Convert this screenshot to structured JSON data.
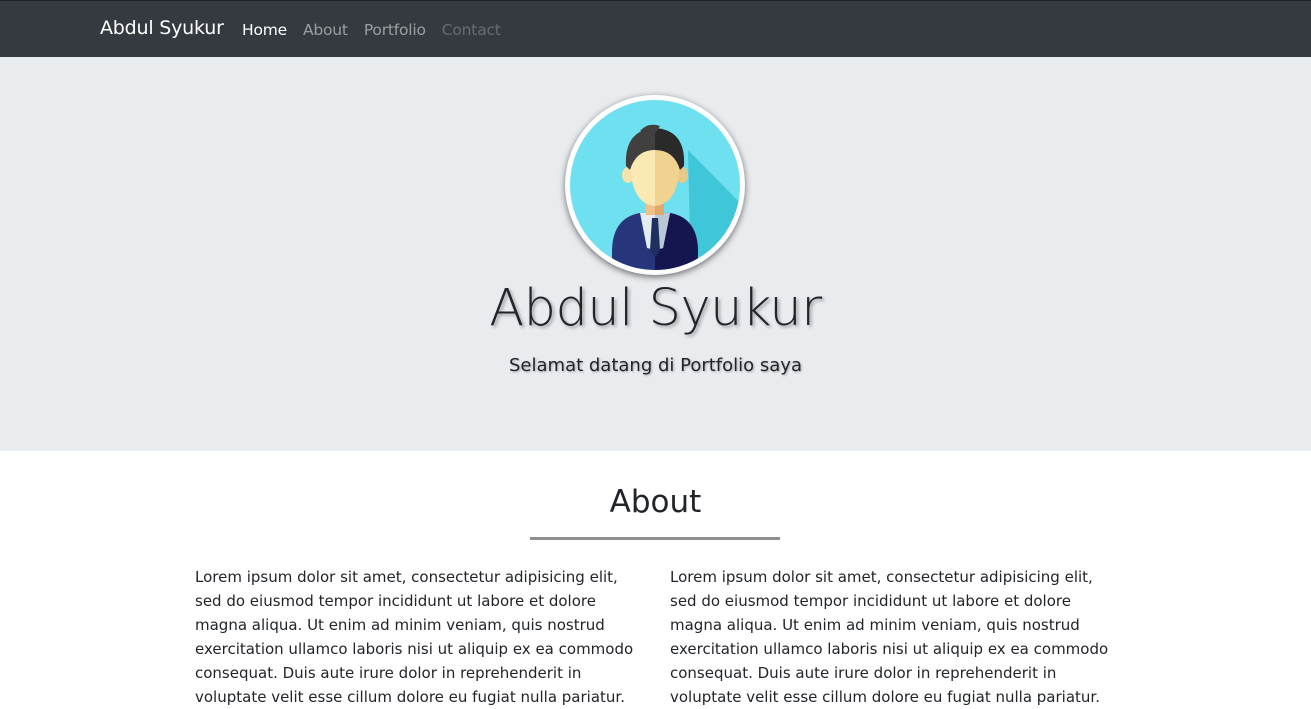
{
  "navbar": {
    "brand": "Abdul Syukur",
    "items": [
      {
        "label": "Home",
        "state": "active"
      },
      {
        "label": "About",
        "state": "normal"
      },
      {
        "label": "Portfolio",
        "state": "normal"
      },
      {
        "label": "Contact",
        "state": "dim"
      }
    ]
  },
  "hero": {
    "avatar_icon": "businessman-avatar-icon",
    "name": "Abdul Syukur",
    "tagline": "Selamat datang di Portfolio saya"
  },
  "about": {
    "title": "About",
    "columns": [
      "Lorem ipsum dolor sit amet, consectetur adipisicing elit, sed do eiusmod tempor incididunt ut labore et dolore magna aliqua. Ut enim ad minim veniam, quis nostrud exercitation ullamco laboris nisi ut aliquip ex ea commodo consequat. Duis aute irure dolor in reprehenderit in voluptate velit esse cillum dolore eu fugiat nulla pariatur.",
      "Lorem ipsum dolor sit amet, consectetur adipisicing elit, sed do eiusmod tempor incididunt ut labore et dolore magna aliqua. Ut enim ad minim veniam, quis nostrud exercitation ullamco laboris nisi ut aliquip ex ea commodo consequat. Duis aute irure dolor in reprehenderit in voluptate velit esse cillum dolore eu fugiat nulla pariatur."
    ]
  },
  "colors": {
    "navbar_bg": "#343a40",
    "jumbotron_bg": "#e9ecef",
    "avatar_bg": "#6fe0ef"
  }
}
